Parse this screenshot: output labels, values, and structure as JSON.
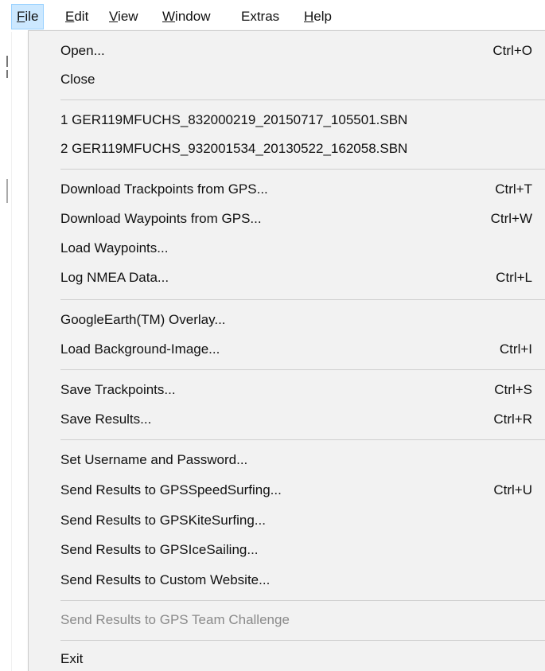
{
  "menubar": {
    "items": [
      {
        "label": "File",
        "active": true
      },
      {
        "label": "Edit",
        "active": false
      },
      {
        "label": "View",
        "active": false
      },
      {
        "label": "Window",
        "active": false
      },
      {
        "label": "Extras",
        "active": false
      },
      {
        "label": "Help",
        "active": false
      }
    ]
  },
  "file_menu": {
    "groups": [
      [
        {
          "label": "Open...",
          "shortcut": "Ctrl+O",
          "enabled": true
        },
        {
          "label": "Close",
          "shortcut": "",
          "enabled": true
        }
      ],
      [
        {
          "label": "1 GER119MFUCHS_832000219_20150717_105501.SBN",
          "shortcut": "",
          "enabled": true
        },
        {
          "label": "2 GER119MFUCHS_932001534_20130522_162058.SBN",
          "shortcut": "",
          "enabled": true
        }
      ],
      [
        {
          "label": "Download Trackpoints from GPS...",
          "shortcut": "Ctrl+T",
          "enabled": true
        },
        {
          "label": "Download Waypoints from GPS...",
          "shortcut": "Ctrl+W",
          "enabled": true
        },
        {
          "label": "Load Waypoints...",
          "shortcut": "",
          "enabled": true
        },
        {
          "label": "Log NMEA Data...",
          "shortcut": "Ctrl+L",
          "enabled": true
        }
      ],
      [
        {
          "label": "GoogleEarth(TM) Overlay...",
          "shortcut": "",
          "enabled": true
        },
        {
          "label": "Load Background-Image...",
          "shortcut": "Ctrl+I",
          "enabled": true
        }
      ],
      [
        {
          "label": "Save Trackpoints...",
          "shortcut": "Ctrl+S",
          "enabled": true
        },
        {
          "label": "Save Results...",
          "shortcut": "Ctrl+R",
          "enabled": true
        }
      ],
      [
        {
          "label": "Set Username and Password...",
          "shortcut": "",
          "enabled": true
        },
        {
          "label": "Send Results to GPSSpeedSurfing...",
          "shortcut": "Ctrl+U",
          "enabled": true
        },
        {
          "label": "Send Results to GPSKiteSurfing...",
          "shortcut": "",
          "enabled": true
        },
        {
          "label": "Send Results to GPSIceSailing...",
          "shortcut": "",
          "enabled": true
        },
        {
          "label": "Send Results to Custom Website...",
          "shortcut": "",
          "enabled": true
        }
      ],
      [
        {
          "label": "Send Results to GPS Team Challenge",
          "shortcut": "",
          "enabled": false
        }
      ],
      [
        {
          "label": "Exit",
          "shortcut": "",
          "enabled": true
        }
      ]
    ]
  },
  "colors": {
    "menu_background": "#f2f2f2",
    "active_menubar_bg": "#cce8ff",
    "active_menubar_border": "#99d1ff",
    "disabled_text": "#8a8a8a",
    "separator": "#cfcfcf"
  }
}
